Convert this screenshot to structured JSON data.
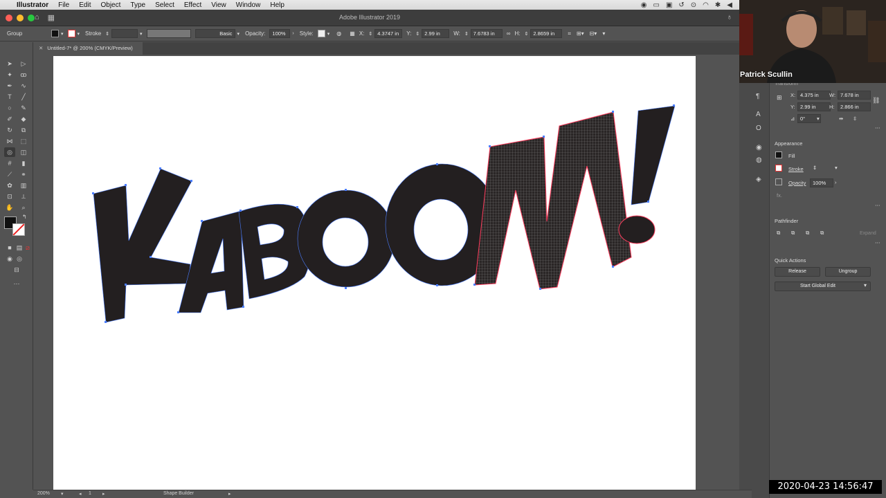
{
  "menubar": {
    "app_name": "Illustrator",
    "items": [
      "File",
      "Edit",
      "Object",
      "Type",
      "Select",
      "Effect",
      "View",
      "Window",
      "Help"
    ]
  },
  "window": {
    "title": "Adobe Illustrator 2019"
  },
  "control_bar": {
    "selection_label": "Group",
    "stroke_label": "Stroke",
    "brush_label": "Basic",
    "opacity_label": "Opacity:",
    "opacity_value": "100%",
    "style_label": "Style:",
    "x_label": "X:",
    "x_value": "4.3747 in",
    "y_label": "Y:",
    "y_value": "2.99 in",
    "w_label": "W:",
    "w_value": "7.6783 in",
    "h_label": "H:",
    "h_value": "2.8659 in"
  },
  "document_tab": {
    "label": "Untitled-7* @ 200% (CMYK/Preview)"
  },
  "artwork": {
    "text": "KABOOM!"
  },
  "status_bar": {
    "zoom": "200%",
    "artboard": "1",
    "tool": "Shape Builder"
  },
  "transform_panel": {
    "title": "Transform",
    "x_label": "X:",
    "x_value": "4.375 in",
    "y_label": "Y:",
    "y_value": "2.99 in",
    "w_label": "W:",
    "w_value": "7.678 in",
    "h_label": "H:",
    "h_value": "2.866 in",
    "angle_label": "⊿",
    "angle_value": "0°"
  },
  "appearance_panel": {
    "title": "Appearance",
    "fill_label": "Fill",
    "stroke_label": "Stroke",
    "opacity_label": "Opacity",
    "opacity_value": "100%",
    "fx_label": "fx."
  },
  "pathfinder_panel": {
    "title": "Pathfinder",
    "expand_label": "Expand"
  },
  "quick_actions": {
    "title": "Quick Actions",
    "release_label": "Release",
    "ungroup_label": "Ungroup",
    "global_edit_label": "Start Global Edit"
  },
  "webcam": {
    "name": "Patrick Scullin"
  },
  "overlay": {
    "timestamp": "2020-04-23 14:56:47"
  },
  "colors": {
    "ui_background": "#535353",
    "artboard": "#ffffff",
    "art_fill": "#231f20",
    "selection_blue": "#4a7dff",
    "selection_red": "#ff3b5c"
  }
}
